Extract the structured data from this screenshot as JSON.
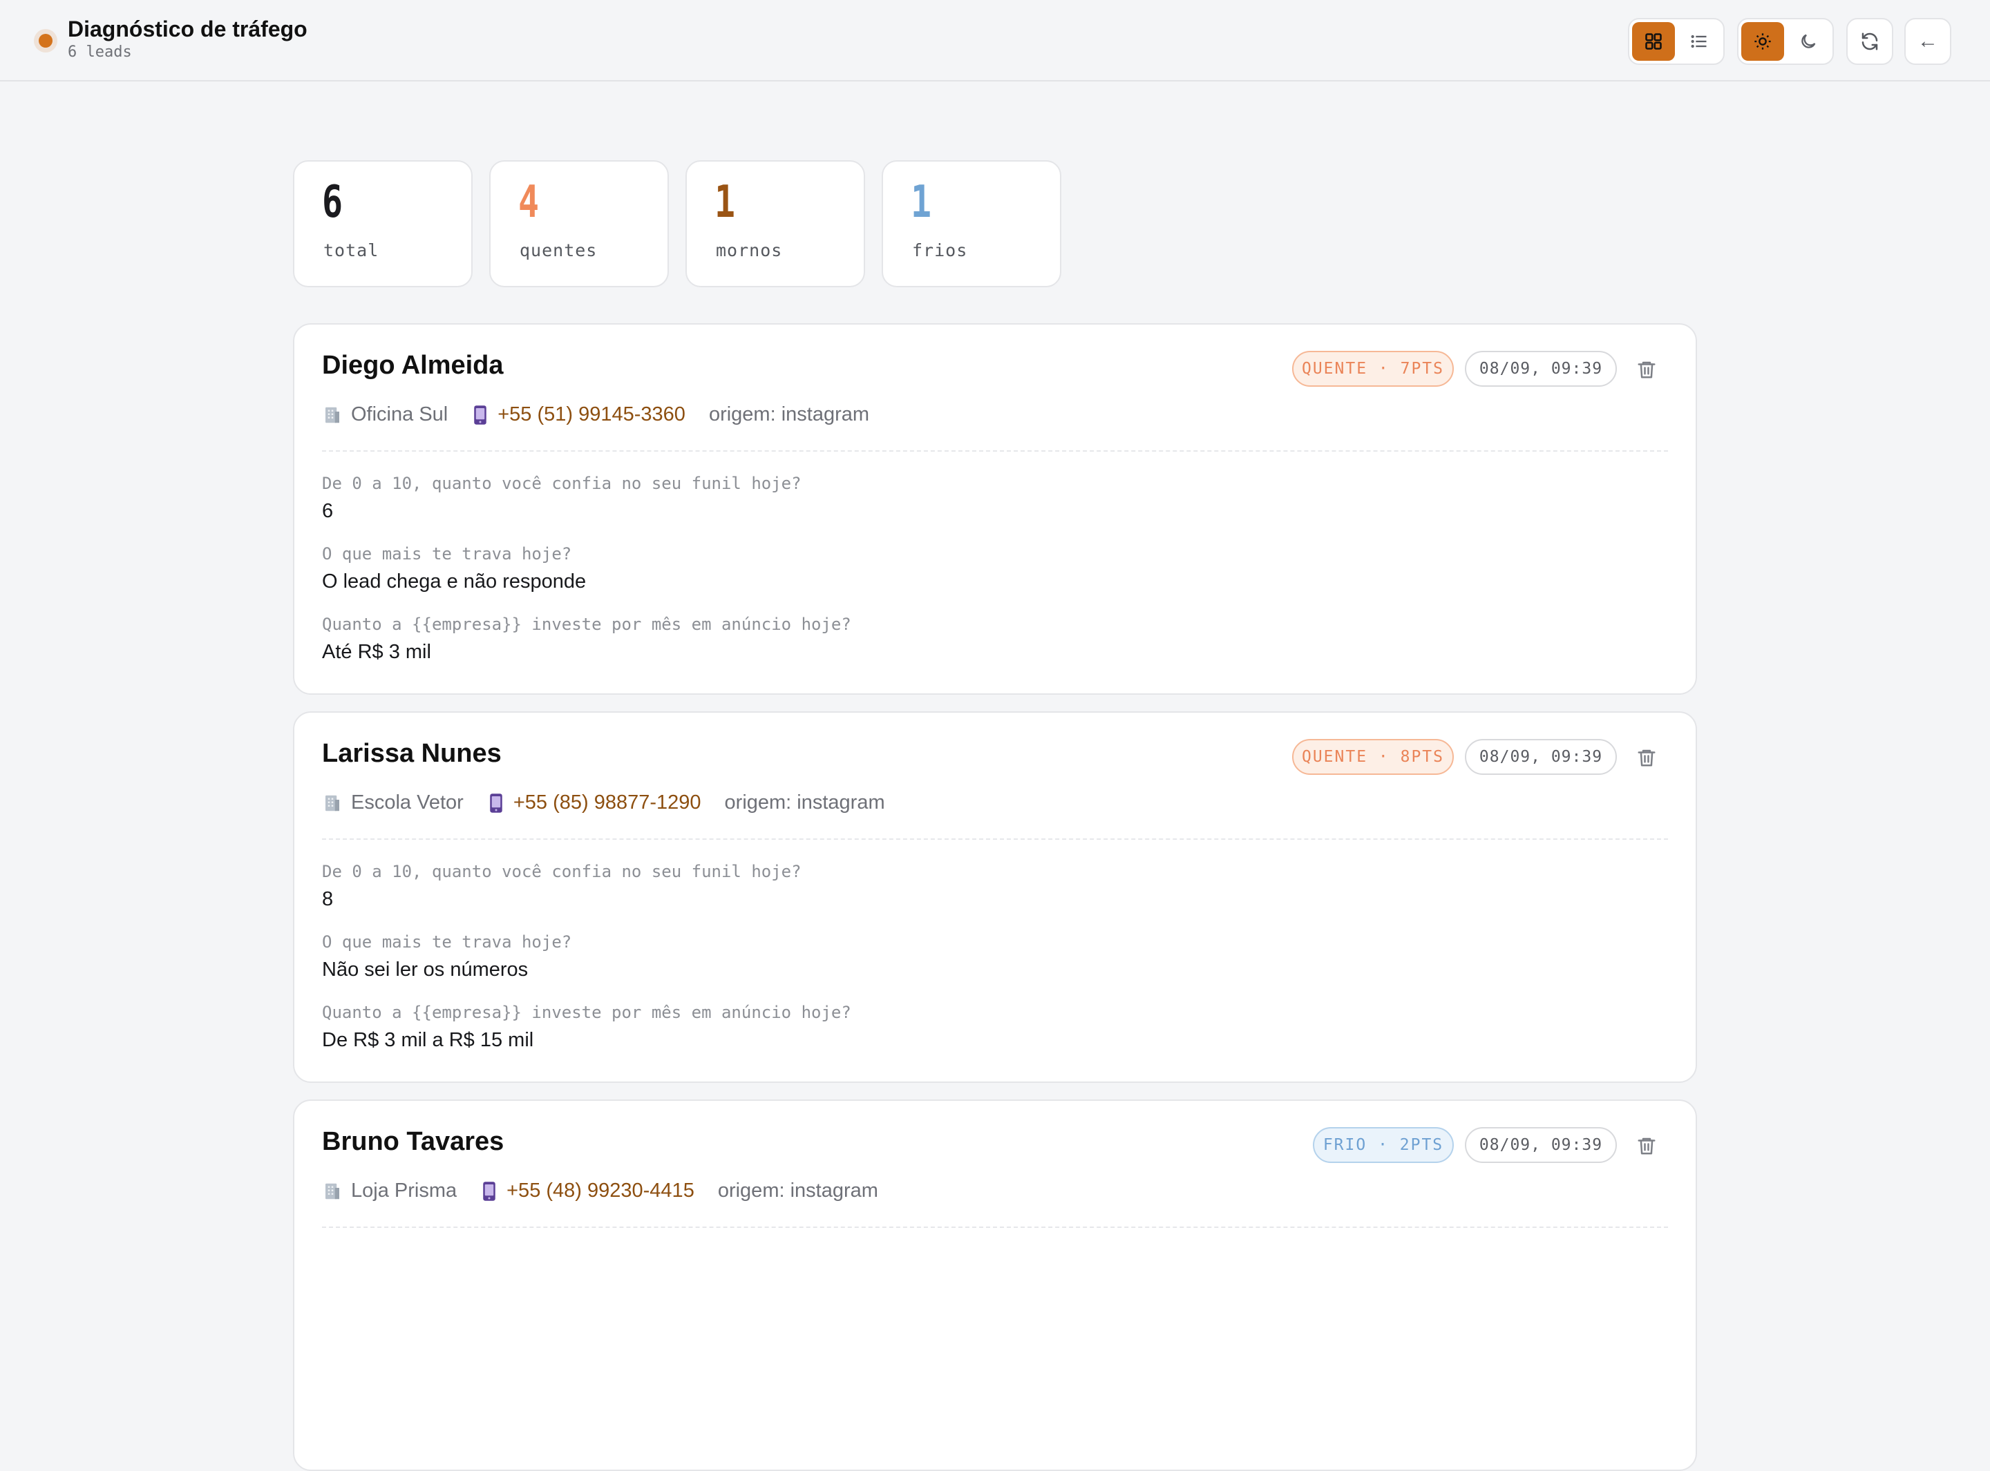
{
  "header": {
    "title": "Diagnóstico de tráfego",
    "subtitle": "6 leads"
  },
  "toolbar": {
    "view_grid_icon": "grid-icon",
    "view_list_icon": "list-icon",
    "light_icon": "sun-icon",
    "dark_icon": "moon-icon",
    "refresh_icon": "refresh-icon",
    "back_label": "←"
  },
  "stats": [
    {
      "value": "6",
      "label": "total",
      "color": "#1b1b1f"
    },
    {
      "value": "4",
      "label": "quentes",
      "color": "#f08a5a"
    },
    {
      "value": "1",
      "label": "mornos",
      "color": "#9a5414"
    },
    {
      "value": "1",
      "label": "frios",
      "color": "#6fa3d3"
    }
  ],
  "leads": [
    {
      "name": "Diego Almeida",
      "company": "Oficina Sul",
      "phone": "+55 (51) 99145-3360",
      "origin": "origem: instagram",
      "badge": "QUENTE · 7PTS",
      "date": "08/09, 09:39",
      "qa": [
        {
          "q": "De 0 a 10, quanto você confia no seu funil hoje?",
          "a": "6"
        },
        {
          "q": "O que mais te trava hoje?",
          "a": "O lead chega e não responde"
        },
        {
          "q": "Quanto a {{empresa}} investe por mês em anúncio hoje?",
          "a": "Até R$ 3 mil"
        }
      ]
    },
    {
      "name": "Larissa Nunes",
      "company": "Escola Vetor",
      "phone": "+55 (85) 98877-1290",
      "origin": "origem: instagram",
      "badge": "QUENTE · 8PTS",
      "date": "08/09, 09:39",
      "qa": [
        {
          "q": "De 0 a 10, quanto você confia no seu funil hoje?",
          "a": "8"
        },
        {
          "q": "O que mais te trava hoje?",
          "a": "Não sei ler os números"
        },
        {
          "q": "Quanto a {{empresa}} investe por mês em anúncio hoje?",
          "a": "De R$ 3 mil a R$ 15 mil"
        }
      ]
    },
    {
      "name": "Bruno Tavares",
      "company": "Loja Prisma",
      "phone": "+55 (48) 99230-4415",
      "origin": "origem: instagram",
      "badge": "FRIO · 2PTS",
      "date": "08/09, 09:39",
      "qa": []
    }
  ]
}
